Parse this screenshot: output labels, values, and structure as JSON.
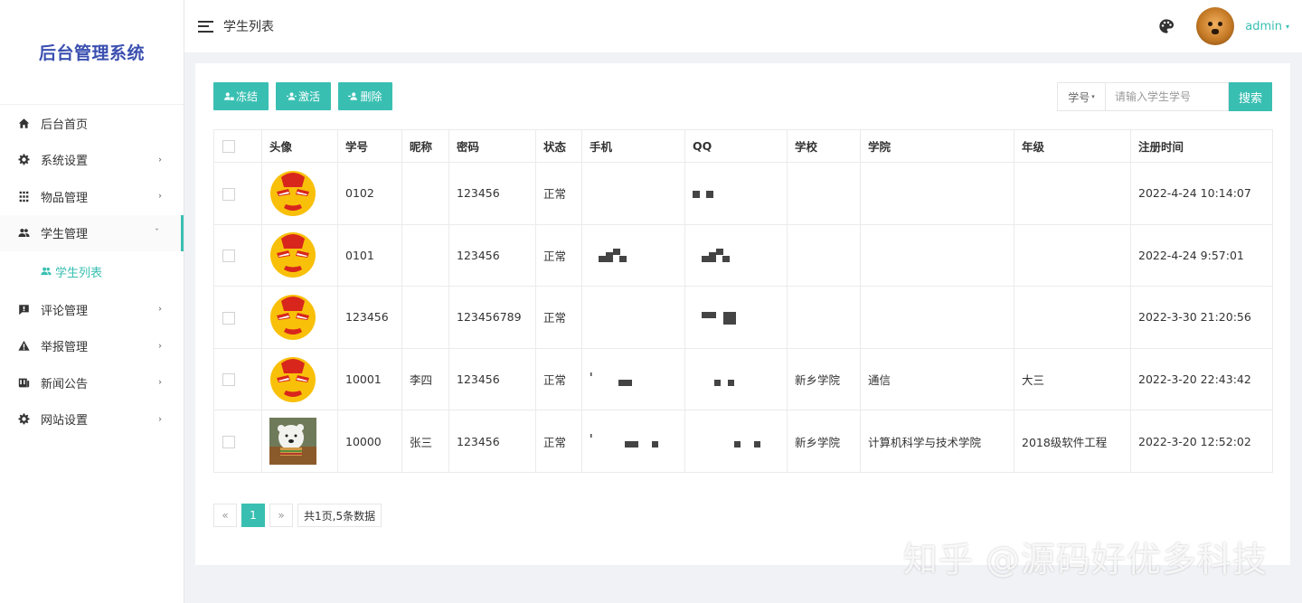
{
  "app": {
    "title": "后台管理系统"
  },
  "sidebar": {
    "items": [
      {
        "label": "后台首页",
        "icon": "home-icon",
        "chevron": ""
      },
      {
        "label": "系统设置",
        "icon": "gear-icon",
        "chevron": "›"
      },
      {
        "label": "物品管理",
        "icon": "grid-icon",
        "chevron": "›"
      },
      {
        "label": "学生管理",
        "icon": "users-icon",
        "chevron": "ˇ"
      },
      {
        "label": "评论管理",
        "icon": "comment-icon",
        "chevron": "›"
      },
      {
        "label": "举报管理",
        "icon": "warning-icon",
        "chevron": "›"
      },
      {
        "label": "新闻公告",
        "icon": "news-icon",
        "chevron": "›"
      },
      {
        "label": "网站设置",
        "icon": "gear-icon",
        "chevron": "›"
      }
    ],
    "subitem": {
      "label": "学生列表",
      "icon": "users-icon"
    }
  },
  "header": {
    "page_title": "学生列表",
    "user_name": "admin",
    "user_caret": "▾"
  },
  "toolbar": {
    "freeze_label": "冻结",
    "activate_label": "激活",
    "delete_label": "删除"
  },
  "search": {
    "type_label": "学号",
    "type_caret": "▾",
    "placeholder": "请输入学生学号",
    "button_label": "搜索"
  },
  "table": {
    "headers": [
      "头像",
      "学号",
      "昵称",
      "密码",
      "状态",
      "手机",
      "QQ",
      "学校",
      "学院",
      "年级",
      "注册时间"
    ],
    "rows": [
      {
        "avatar": "ironman",
        "sid": "0102",
        "nickname": "",
        "password": "123456",
        "status": "正常",
        "school": "",
        "college": "",
        "grade": "",
        "reg_time": "2022-4-24 10:14:07"
      },
      {
        "avatar": "ironman",
        "sid": "0101",
        "nickname": "",
        "password": "123456",
        "status": "正常",
        "school": "",
        "college": "",
        "grade": "",
        "reg_time": "2022-4-24 9:57:01"
      },
      {
        "avatar": "ironman",
        "sid": "123456",
        "nickname": "",
        "password": "123456789",
        "status": "正常",
        "school": "",
        "college": "",
        "grade": "",
        "reg_time": "2022-3-30 21:20:56"
      },
      {
        "avatar": "ironman",
        "sid": "10001",
        "nickname": "李四",
        "password": "123456",
        "status": "正常",
        "school": "新乡学院",
        "college": "通信",
        "grade": "大三",
        "reg_time": "2022-3-20 22:43:42"
      },
      {
        "avatar": "bear",
        "sid": "10000",
        "nickname": "张三",
        "password": "123456",
        "status": "正常",
        "school": "新乡学院",
        "college": "计算机科学与技术学院",
        "grade": "2018级软件工程",
        "reg_time": "2022-3-20 12:52:02"
      }
    ]
  },
  "pagination": {
    "prev_label": "«",
    "current_page": "1",
    "next_label": "»",
    "info": "共1页,5条数据"
  },
  "watermark": {
    "text": "知乎 @源码好优多科技"
  },
  "colors": {
    "accent": "#39bfb2",
    "title": "#3a4fb0",
    "time": "#2e9c8a"
  }
}
